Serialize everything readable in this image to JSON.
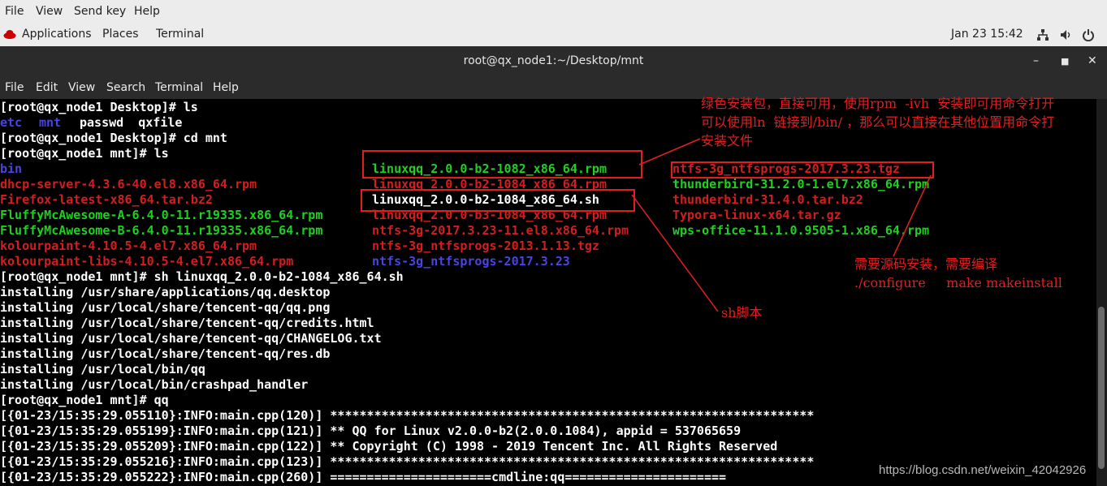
{
  "app_menu": [
    "File",
    "View",
    "Send key",
    "Help"
  ],
  "panel": {
    "applications": "Applications",
    "places": "Places",
    "terminal": "Terminal",
    "datetime": "Jan 23 15:42"
  },
  "window_title": "root@qx_node1:~/Desktop/mnt",
  "terminal_menu": [
    "File",
    "Edit",
    "View",
    "Search",
    "Terminal",
    "Help"
  ],
  "lines": {
    "l1": "[root@qx_node1 Desktop]# ls",
    "l2a": "etc",
    "l2b": "mnt",
    "l2c": "passwd  qxfile",
    "l3": "[root@qx_node1 Desktop]# cd mnt",
    "l4": "[root@qx_node1 mnt]# ls",
    "ls_col1": [
      "bin",
      "dhcp-server-4.3.6-40.el8.x86_64.rpm",
      "Firefox-latest-x86_64.tar.bz2",
      "FluffyMcAwesome-A-6.4.0-11.r19335.x86_64.rpm",
      "FluffyMcAwesome-B-6.4.0-11.r19335.x86_64.rpm",
      "kolourpaint-4.10.5-4.el7.x86_64.rpm",
      "kolourpaint-libs-4.10.5-4.el7.x86_64.rpm"
    ],
    "ls_col2": [
      "linuxqq_2.0.0-b2-1082_x86_64.rpm",
      "linuxqq_2.0.0-b2-1084_x86_64.rpm",
      "linuxqq_2.0.0-b2-1084_x86_64.sh",
      "linuxqq_2.0.0-b3-1084_x86_64.rpm",
      "ntfs-3g-2017.3.23-11.el8.x86_64.rpm",
      "ntfs-3g_ntfsprogs-2013.1.13.tgz",
      "ntfs-3g_ntfsprogs-2017.3.23"
    ],
    "ls_col3": [
      "ntfs-3g_ntfsprogs-2017.3.23.tgz",
      "thunderbird-31.2.0-1.el7.x86_64.rpm",
      "thunderbird-31.4.0.tar.bz2",
      "Typora-linux-x64.tar.gz",
      "wps-office-11.1.0.9505-1.x86_64.rpm"
    ],
    "l12": "[root@qx_node1 mnt]# sh linuxqq_2.0.0-b2-1084_x86_64.sh",
    "install": [
      "installing /usr/share/applications/qq.desktop",
      "installing /usr/local/share/tencent-qq/qq.png",
      "installing /usr/local/share/tencent-qq/credits.html",
      "installing /usr/local/share/tencent-qq/CHANGELOG.txt",
      "installing /usr/local/share/tencent-qq/res.db",
      "installing /usr/local/bin/qq",
      "installing /usr/local/bin/crashpad_handler"
    ],
    "l20": "[root@qx_node1 mnt]# qq",
    "log": [
      "[{01-23/15:35:29.055110}:INFO:main.cpp(120)] ******************************************************************",
      "[{01-23/15:35:29.055199}:INFO:main.cpp(121)] ** QQ for Linux v2.0.0-b2(2.0.0.1084), appid = 537065659",
      "[{01-23/15:35:29.055209}:INFO:main.cpp(122)] ** Copyright (C) 1998 - 2019 Tencent Inc. All Rights Reserved",
      "[{01-23/15:35:29.055216}:INFO:main.cpp(123)] ******************************************************************",
      "[{01-23/15:35:29.055222}:INFO:main.cpp(260)] ======================cmdline:qq======================"
    ]
  },
  "annotations": {
    "green_pkg": "绿色安装包，直接可用，使用rpm  -ivh  安装即可用命令打开\n可以使用ln  链接到/bin/ ，那么可以直接在其他位置用命令打\n安装文件",
    "source": "需要源码安装，需要编译\n./configure     make makeinstall",
    "sh": "sh脚本"
  },
  "watermark": "https://blog.csdn.net/weixin_42042926",
  "colors": {
    "red": "#d41e1e",
    "green": "#1fd11f",
    "blue": "#4a43e6",
    "note": "#e02020"
  }
}
